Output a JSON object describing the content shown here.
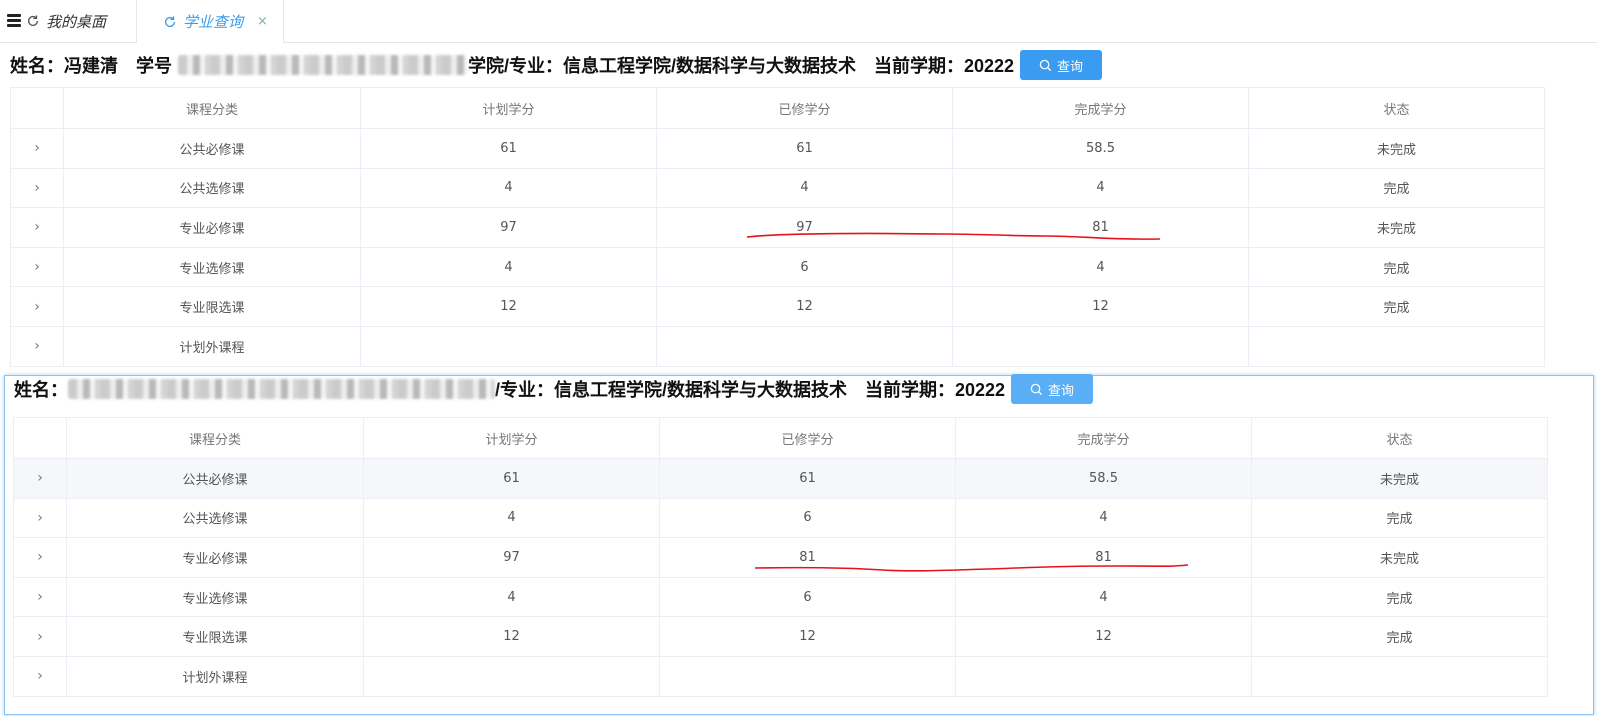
{
  "tabs": {
    "home_label": "我的桌面",
    "active_label": "学业查询",
    "close_glyph": "×"
  },
  "panel1": {
    "name_label": "姓名：冯建清",
    "student_no_label": "学号",
    "college_label_tail": "学院/专业：信息工程学院/数据科学与大数据技术",
    "term_label": "当前学期：20222",
    "search_label": "查询",
    "headers": [
      "课程分类",
      "计划学分",
      "已修学分",
      "完成学分",
      "状态"
    ],
    "rows": [
      {
        "category": "公共必修课",
        "plan": "61",
        "taken": "61",
        "done": "58.5",
        "status": "未完成"
      },
      {
        "category": "公共选修课",
        "plan": "4",
        "taken": "4",
        "done": "4",
        "status": "完成"
      },
      {
        "category": "专业必修课",
        "plan": "97",
        "taken": "97",
        "done": "81",
        "status": "未完成"
      },
      {
        "category": "专业选修课",
        "plan": "4",
        "taken": "6",
        "done": "4",
        "status": "完成"
      },
      {
        "category": "专业限选课",
        "plan": "12",
        "taken": "12",
        "done": "12",
        "status": "完成"
      },
      {
        "category": "计划外课程",
        "plan": "",
        "taken": "",
        "done": "",
        "status": ""
      }
    ]
  },
  "panel2": {
    "name_label": "姓名：",
    "college_label_tail": "/专业：信息工程学院/数据科学与大数据技术",
    "term_label": "当前学期：20222",
    "search_label": "查询",
    "headers": [
      "课程分类",
      "计划学分",
      "已修学分",
      "完成学分",
      "状态"
    ],
    "rows": [
      {
        "category": "公共必修课",
        "plan": "61",
        "taken": "61",
        "done": "58.5",
        "status": "未完成"
      },
      {
        "category": "公共选修课",
        "plan": "4",
        "taken": "6",
        "done": "4",
        "status": "完成"
      },
      {
        "category": "专业必修课",
        "plan": "97",
        "taken": "81",
        "done": "81",
        "status": "未完成"
      },
      {
        "category": "专业选修课",
        "plan": "4",
        "taken": "6",
        "done": "4",
        "status": "完成"
      },
      {
        "category": "专业限选课",
        "plan": "12",
        "taken": "12",
        "done": "12",
        "status": "完成"
      },
      {
        "category": "计划外课程",
        "plan": "",
        "taken": "",
        "done": "",
        "status": ""
      }
    ]
  },
  "annotation_color": "#e8101a",
  "accent_color": "#3a9cf0"
}
